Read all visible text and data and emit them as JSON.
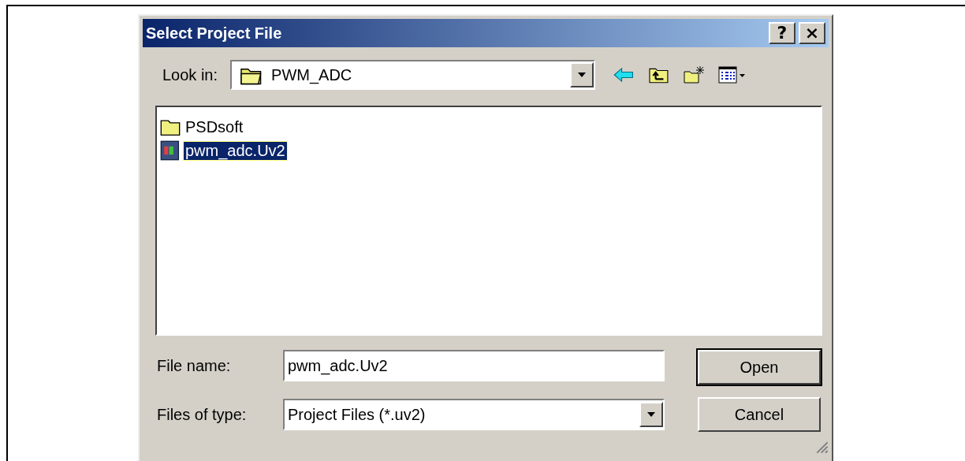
{
  "window": {
    "title": "Select Project File",
    "help_button": "?",
    "close_button": "×"
  },
  "look_in": {
    "label": "Look in:",
    "value": "PWM_ADC"
  },
  "files": [
    {
      "name": "PSDsoft",
      "kind": "folder",
      "selected": false
    },
    {
      "name": "pwm_adc.Uv2",
      "kind": "project",
      "selected": true
    }
  ],
  "file_name": {
    "label": "File name:",
    "value": "pwm_adc.Uv2"
  },
  "file_type": {
    "label": "Files of type:",
    "value": "Project Files (*.uv2)"
  },
  "buttons": [
    {
      "label": "Open",
      "default": true
    },
    {
      "label": "Cancel",
      "default": false
    }
  ]
}
